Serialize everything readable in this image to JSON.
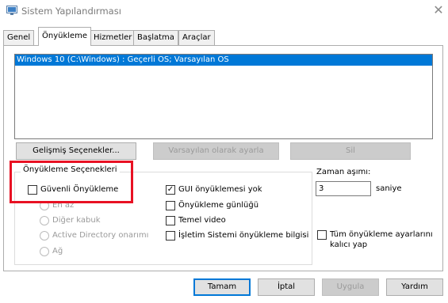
{
  "window": {
    "title": "Sistem Yapılandırması",
    "close_glyph": "✕",
    "icon": "system-config-icon"
  },
  "tabs": [
    {
      "label": "Genel"
    },
    {
      "label": "Önyükleme"
    },
    {
      "label": "Hizmetler"
    },
    {
      "label": "Başlatma"
    },
    {
      "label": "Araçlar"
    }
  ],
  "boot_list": {
    "entries": [
      "Windows 10 (C:\\Windows) : Geçerli OS; Varsayılan OS"
    ]
  },
  "buttons": {
    "advanced": "Gelişmiş Seçenekler...",
    "set_default": "Varsayılan olarak ayarla",
    "delete": "Sil"
  },
  "boot_options": {
    "title": "Önyükleme Seçenekleri",
    "safe_boot": "Güvenli Önyükleme",
    "minimal": "En az",
    "alternate_shell": "Diğer kabuk",
    "active_directory": "Active Directory onarımı",
    "network": "Ağ",
    "no_gui": "GUI önyüklemesi yok",
    "boot_log": "Önyükleme günlüğü",
    "base_video": "Temel video",
    "os_info": "İşletim Sistemi önyükleme bilgisi",
    "check": "✓"
  },
  "timeout": {
    "label": "Zaman aşımı:",
    "value": "3",
    "unit": "saniye"
  },
  "permanent": {
    "label_line1": "Tüm önyükleme ayarlarını",
    "label_line2": "kalıcı yap"
  },
  "footer": {
    "ok": "Tamam",
    "cancel": "İptal",
    "apply": "Uygula",
    "help": "Yardım"
  },
  "colors": {
    "selection": "#0078d7",
    "highlight_box": "#e81123"
  }
}
